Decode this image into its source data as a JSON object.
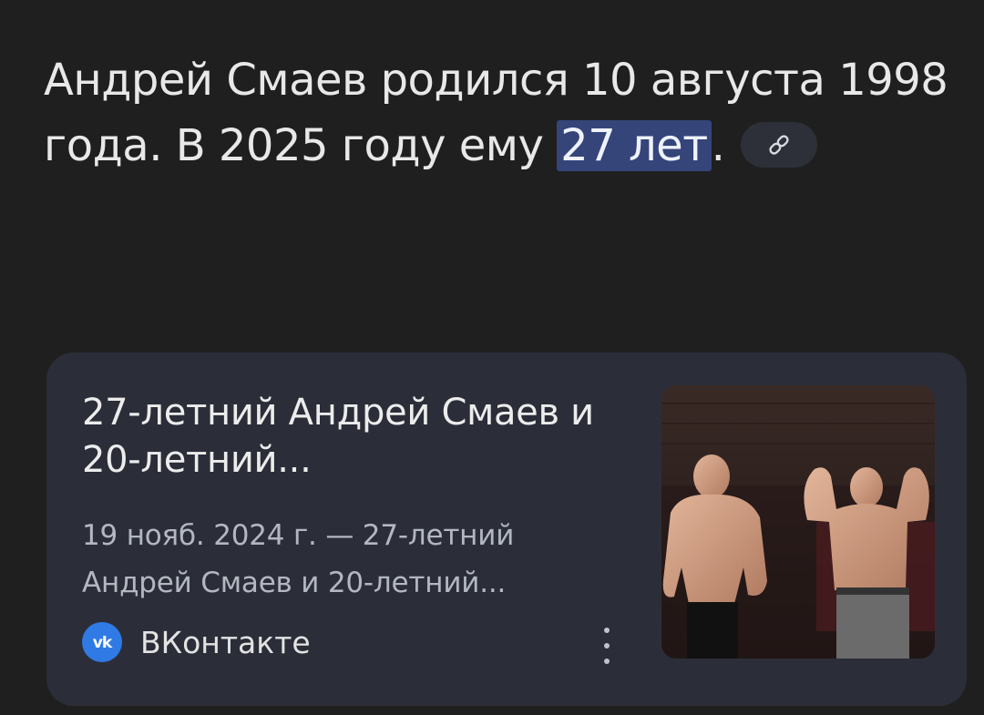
{
  "answer": {
    "text_before": "Андрей Смаев родился 10 августа 1998 года. В 2025 году ему ",
    "highlight": "27 лет",
    "text_after": ".",
    "link_icon": "link-icon"
  },
  "result_card": {
    "title": "27-летний Андрей Смаев и 20-летний...",
    "snippet": "19 нояб. 2024 г. — 27-летний Андрей Смаев и 20-летний...",
    "source": {
      "name": "ВКонтакте",
      "logo_text": "vk",
      "logo_color": "#2f7ae5"
    },
    "more_icon": "more-vert-icon",
    "thumbnail": "two-bodybuilders-photo"
  },
  "colors": {
    "background": "#1f1f1f",
    "card": "#2b2e38",
    "highlight": "#35457a"
  }
}
